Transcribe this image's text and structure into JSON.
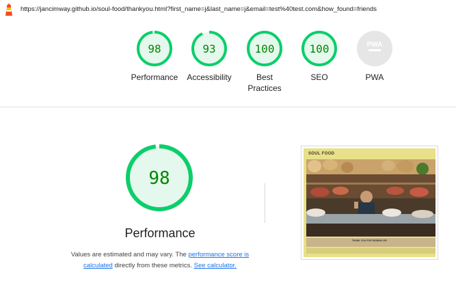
{
  "url_bar": {
    "url": "https://jancimway.github.io/soul-food/thankyou.html?first_name=j&last_name=j&email=test%40test.com&how_found=friends"
  },
  "summary_gauges": [
    {
      "label": "Performance",
      "score": "98",
      "value": 0.98
    },
    {
      "label": "Accessibility",
      "score": "93",
      "value": 0.93
    },
    {
      "label": "Best Practices",
      "score": "100",
      "value": 1.0
    },
    {
      "label": "SEO",
      "score": "100",
      "value": 1.0
    },
    {
      "label": "PWA",
      "badge": "PWA"
    }
  ],
  "performance": {
    "score": "98",
    "value": 0.98,
    "title": "Performance",
    "desc_prefix": "Values are estimated and may vary. The ",
    "desc_link1": "performance score is calculated",
    "desc_middle": " directly from these metrics. ",
    "desc_link2": "See calculator."
  },
  "thumbnail": {
    "site_title": "SOUL FOOD",
    "thanks_text": "THANK YOU FOR SIGNING UP!"
  },
  "colors": {
    "pass_green": "#0cce6b",
    "pass_fill": "#e5f8ed",
    "score_text": "#008800",
    "link": "#1a73e8"
  }
}
